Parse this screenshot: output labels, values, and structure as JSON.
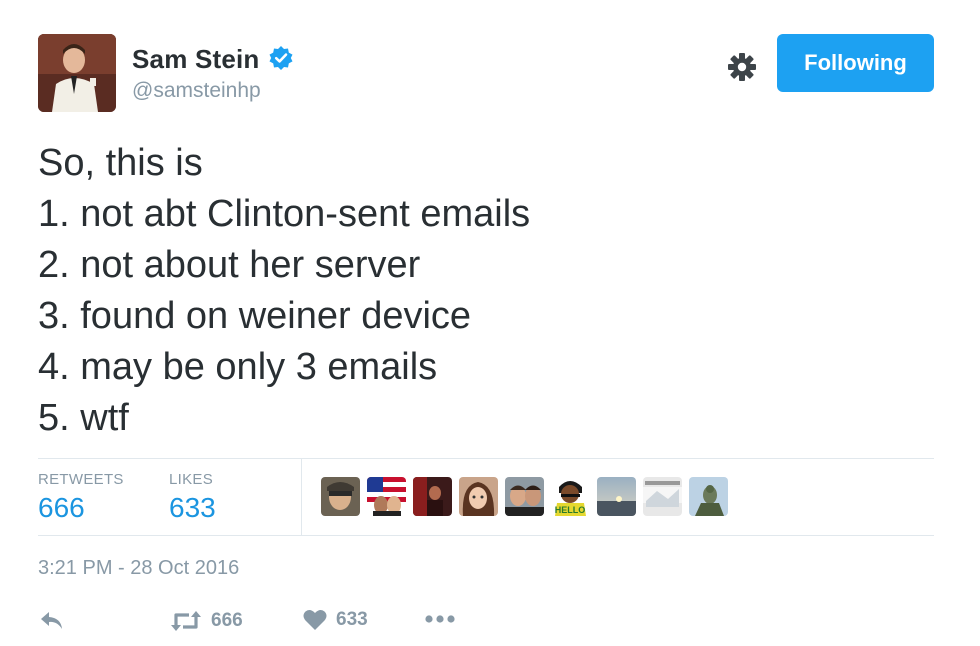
{
  "user": {
    "display_name": "Sam Stein",
    "handle": "@samsteinhp",
    "verified": true
  },
  "header": {
    "settings_icon": "gear-icon",
    "follow_label": "Following"
  },
  "tweet": {
    "lines": [
      "So, this is",
      "1. not abt Clinton-sent emails",
      "2. not about her server",
      "3. found on weiner device",
      "4. may be only 3 emails",
      "5. wtf"
    ]
  },
  "stats": {
    "retweets_label": "RETWEETS",
    "retweets_value": "666",
    "likes_label": "LIKES",
    "likes_value": "633"
  },
  "timestamp": "3:21 PM - 28 Oct 2016",
  "actions": {
    "reply_icon": "reply-icon",
    "retweet_icon": "retweet-icon",
    "retweet_count": "666",
    "like_icon": "heart-icon",
    "like_count": "633",
    "more_icon": "more-icon"
  },
  "colors": {
    "accent": "#1da1f2",
    "link": "#1b95e0",
    "muted": "#8899a6",
    "text": "#292f33"
  }
}
